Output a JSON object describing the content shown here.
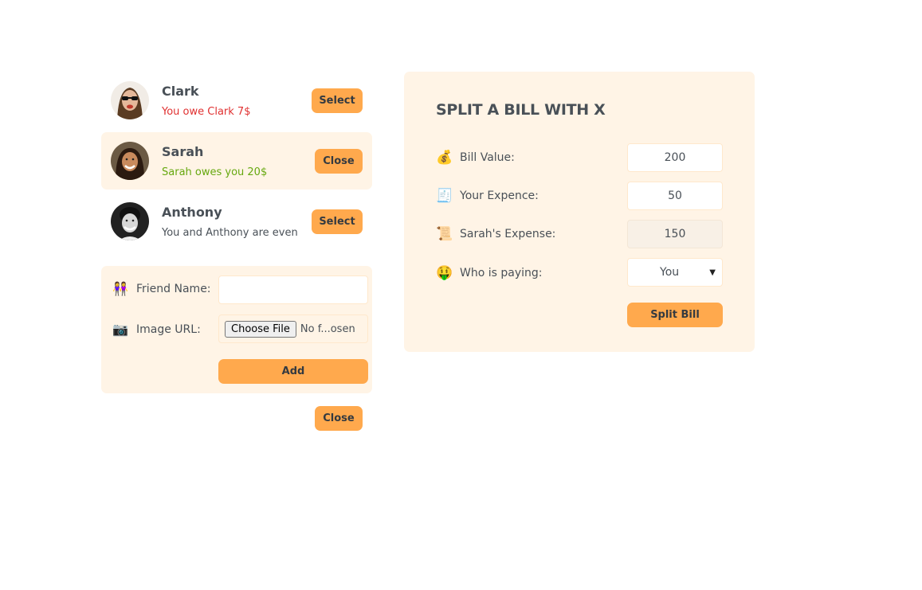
{
  "friends": [
    {
      "name": "Clark",
      "status": "You owe Clark 7$",
      "button": "Select"
    },
    {
      "name": "Sarah",
      "status": "Sarah owes you 20$",
      "button": "Close"
    },
    {
      "name": "Anthony",
      "status": "You and Anthony are even",
      "button": "Select"
    }
  ],
  "add_friend": {
    "name_icon": "👭",
    "name_label": "Friend Name:",
    "name_value": "",
    "image_icon": "📷",
    "image_label": "Image URL:",
    "file_button": "Choose File",
    "file_text": "No f...osen",
    "add_button": "Add"
  },
  "close_button": "Close",
  "split": {
    "title": "SPLIT A BILL WITH X",
    "bill_icon": "💰",
    "bill_label": "Bill Value:",
    "bill_value": "200",
    "your_icon": "🧾",
    "your_label": "Your Expence:",
    "your_value": "50",
    "friend_icon": "📜",
    "friend_label": "Sarah's Expense:",
    "friend_value": "150",
    "payer_icon": "🤑",
    "payer_label": "Who is paying:",
    "payer_value": "You",
    "split_button": "Split Bill"
  },
  "colors": {
    "accent": "#ffa94d",
    "panel": "#fff4e6",
    "owe_red": "#e03131",
    "owed_green": "#66a80f"
  }
}
